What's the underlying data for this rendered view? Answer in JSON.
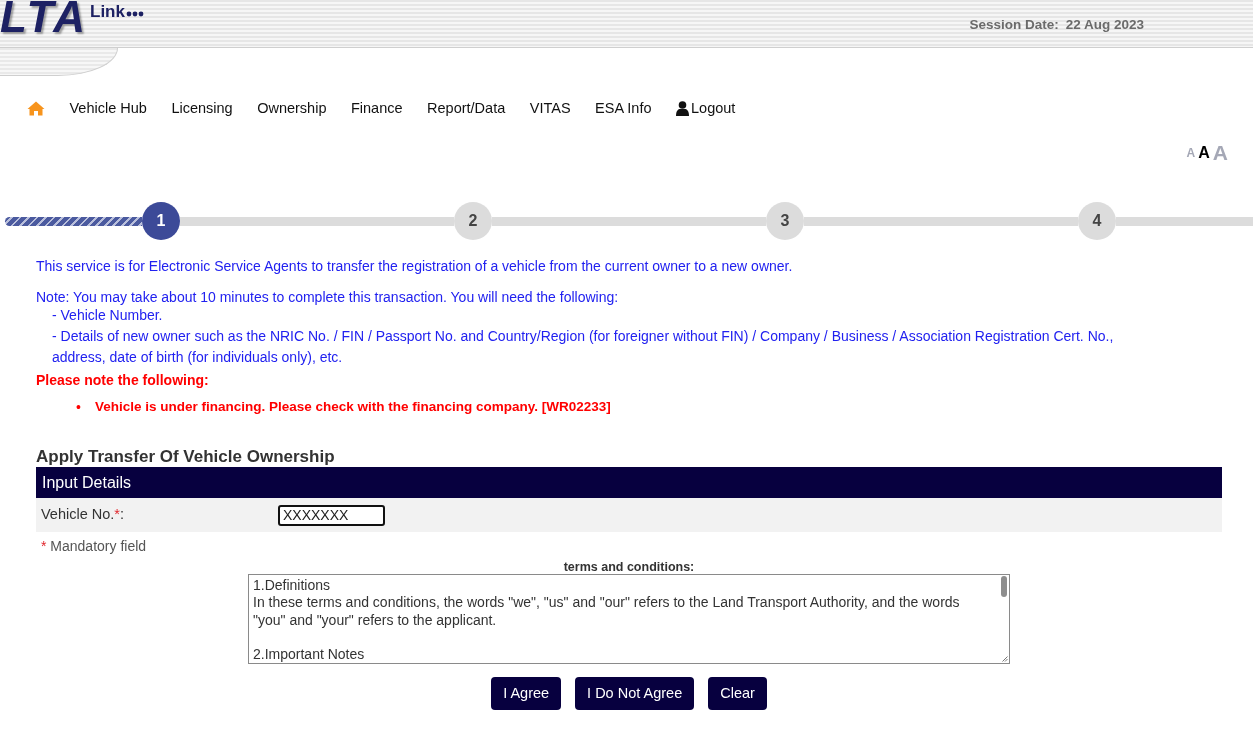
{
  "header": {
    "logo": "LTA",
    "logo_suffix": "Link",
    "session": {
      "label": "Session Date:",
      "value": "22 Aug 2023"
    }
  },
  "nav": [
    {
      "kind": "home"
    },
    {
      "kind": "link",
      "label": "Vehicle Hub"
    },
    {
      "kind": "link",
      "label": "Licensing"
    },
    {
      "kind": "link",
      "label": "Ownership"
    },
    {
      "kind": "link",
      "label": "Finance"
    },
    {
      "kind": "link",
      "label": "Report/Data"
    },
    {
      "kind": "link",
      "label": "VITAS"
    },
    {
      "kind": "link",
      "label": "ESA Info"
    },
    {
      "kind": "logout",
      "label": "Logout"
    }
  ],
  "font_sizes": [
    {
      "kind": "small",
      "label": "A",
      "selected": false
    },
    {
      "kind": "medium",
      "label": "A",
      "selected": true
    },
    {
      "kind": "large",
      "label": "A",
      "selected": false
    }
  ],
  "steps": [
    {
      "label": "1",
      "selected": true
    },
    {
      "label": "2",
      "selected": false
    },
    {
      "label": "3",
      "selected": false
    },
    {
      "label": "4",
      "selected": false
    }
  ],
  "intro": "This service is for Electronic Service Agents to transfer the registration of a vehicle from the current owner to a new owner.",
  "note": {
    "text": "Note: You may take about 10 minutes to complete this transaction. You will need the following:",
    "items": [
      "- Vehicle Number.",
      "- Details of new owner such as the NRIC No. / FIN / Passport No. and Country/Region (for foreigner without FIN) / Company / Business / Association Registration Cert. No., address, date of birth (for individuals only), etc."
    ]
  },
  "warning": {
    "title": "Please note the following:",
    "items": [
      {
        "bullet": "•",
        "text": "Vehicle is under financing. Please check with the financing company. [WR02233]"
      }
    ]
  },
  "form": {
    "title": "Apply Transfer Of Vehicle Ownership",
    "section": "Input Details",
    "fields": [
      {
        "label": "Vehicle No.",
        "mark": "*",
        "label_end": ":",
        "value": "XXXXXXX",
        "focused": true
      }
    ],
    "mandatory": {
      "mark": "*",
      "text": "Mandatory field"
    }
  },
  "terms": {
    "title": "terms and conditions:",
    "sections": [
      {
        "heading": "1.Definitions",
        "text": "In these terms and conditions, the words \"we\", \"us\" and \"our\" refers to the Land Transport Authority, and the words \"you\" and \"your\" refers to the applicant."
      },
      {
        "heading": "2.Important Notes"
      }
    ]
  },
  "buttons": [
    {
      "label": "I Agree"
    },
    {
      "label": "I Do Not Agree"
    },
    {
      "label": "Clear"
    }
  ]
}
